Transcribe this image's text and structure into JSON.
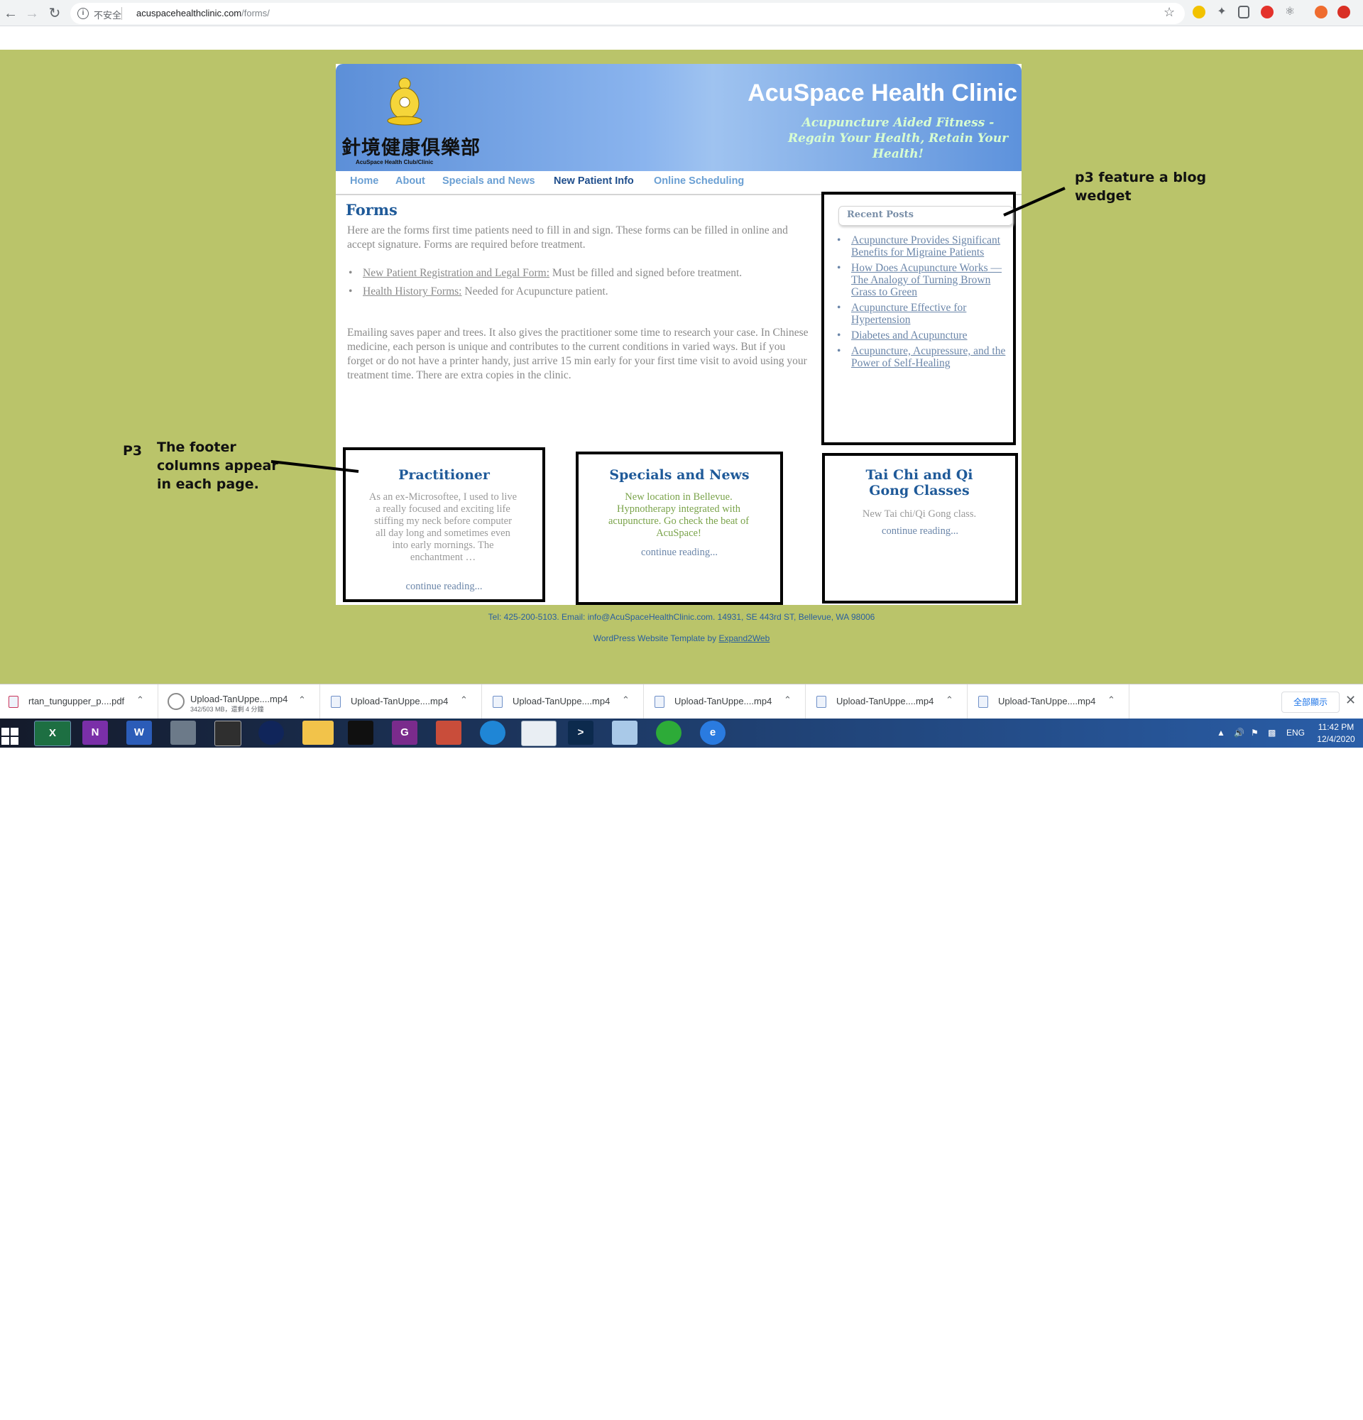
{
  "browser": {
    "security_label": "不安全",
    "url_host": "acuspacehealthclinic.com",
    "url_path": "/forms/"
  },
  "site": {
    "title": "AcuSpace Health Clinic",
    "tagline": "Acupuncture Aided Fitness - Regain Your Health, Retain Your Health!",
    "logo_chinese": "針境健康俱樂部",
    "logo_sub": "AcuSpace Health Club/Clinic",
    "menu": [
      "Home",
      "About",
      "Specials and News",
      "New Patient Info",
      "Online Scheduling"
    ],
    "active_menu": "New Patient Info"
  },
  "content": {
    "heading": "Forms",
    "intro": "Here are the forms first time patients need to fill in and sign. These forms can be filled in online and accept signature. Forms are required before treatment.",
    "forms": [
      {
        "link": "New Patient Registration and Legal Form:",
        "note": " Must be filled and signed before treatment."
      },
      {
        "link": "Health History Forms:",
        "note": " Needed for Acupuncture patient."
      }
    ],
    "extra": "Emailing saves paper and trees. It also gives the practitioner some time to research your case. In Chinese medicine, each person is unique and contributes to the current conditions in varied ways. But if you forget or do not have a printer handy, just arrive 15 min early for your first time visit to avoid using your treatment time. There are extra copies in the clinic."
  },
  "sidebar": {
    "widget_title": "Recent Posts",
    "posts": [
      "Acupuncture Provides Significant Benefits for Migraine Patients",
      "How Does Acupuncture Works — The Analogy of Turning Brown Grass to Green",
      "Acupuncture Effective for Hypertension",
      "Diabetes and Acupuncture",
      "Acupuncture, Acupressure, and the Power of Self-Healing"
    ]
  },
  "footer_columns": [
    {
      "title": "Practitioner",
      "text": "As an ex-Microsoftee, I used to live a really focused and exciting life stiffing my neck before computer all day long and sometimes even into early mornings. The enchantment …",
      "more": "continue reading..."
    },
    {
      "title": "Specials and News",
      "text": "New location in Bellevue. Hypnotherapy integrated with acupuncture. Go check the beat of AcuSpace!",
      "more": "continue reading..."
    },
    {
      "title": "Tai Chi and Qi Gong Classes",
      "text": "New Tai chi/Qi Gong class.",
      "more": "continue reading..."
    }
  ],
  "footer": {
    "contact": "Tel: 425-200-5103. Email: info@AcuSpaceHealthClinic.com. 14931, SE 443rd ST, Bellevue, WA 98006",
    "credit_prefix": "WordPress Website Template by ",
    "credit_link": "Expand2Web"
  },
  "annotations": {
    "blog_widget": "p3 feature a blog wedget",
    "p3_label": "P3",
    "footer_note": "The footer columns appear in each page."
  },
  "downloads": {
    "items": [
      {
        "name": "rtan_tungupper_p....pdf",
        "sub": ""
      },
      {
        "name": "Upload-TanUppe....mp4",
        "sub": "342/503 MB，還剩 4 分鐘"
      },
      {
        "name": "Upload-TanUppe....mp4",
        "sub": ""
      },
      {
        "name": "Upload-TanUppe....mp4",
        "sub": ""
      },
      {
        "name": "Upload-TanUppe....mp4",
        "sub": ""
      },
      {
        "name": "Upload-TanUppe....mp4",
        "sub": ""
      },
      {
        "name": "Upload-TanUppe....mp4",
        "sub": ""
      }
    ],
    "show_all": "全部顯示"
  },
  "taskbar": {
    "language": "ENG",
    "time": "11:42 PM",
    "date": "12/4/2020"
  },
  "colors": {
    "page_background": "#bac46a",
    "heading_blue": "#1f5a99",
    "menu_blue": "#6a9fd3",
    "footer_green_text": "#7aa34a"
  }
}
